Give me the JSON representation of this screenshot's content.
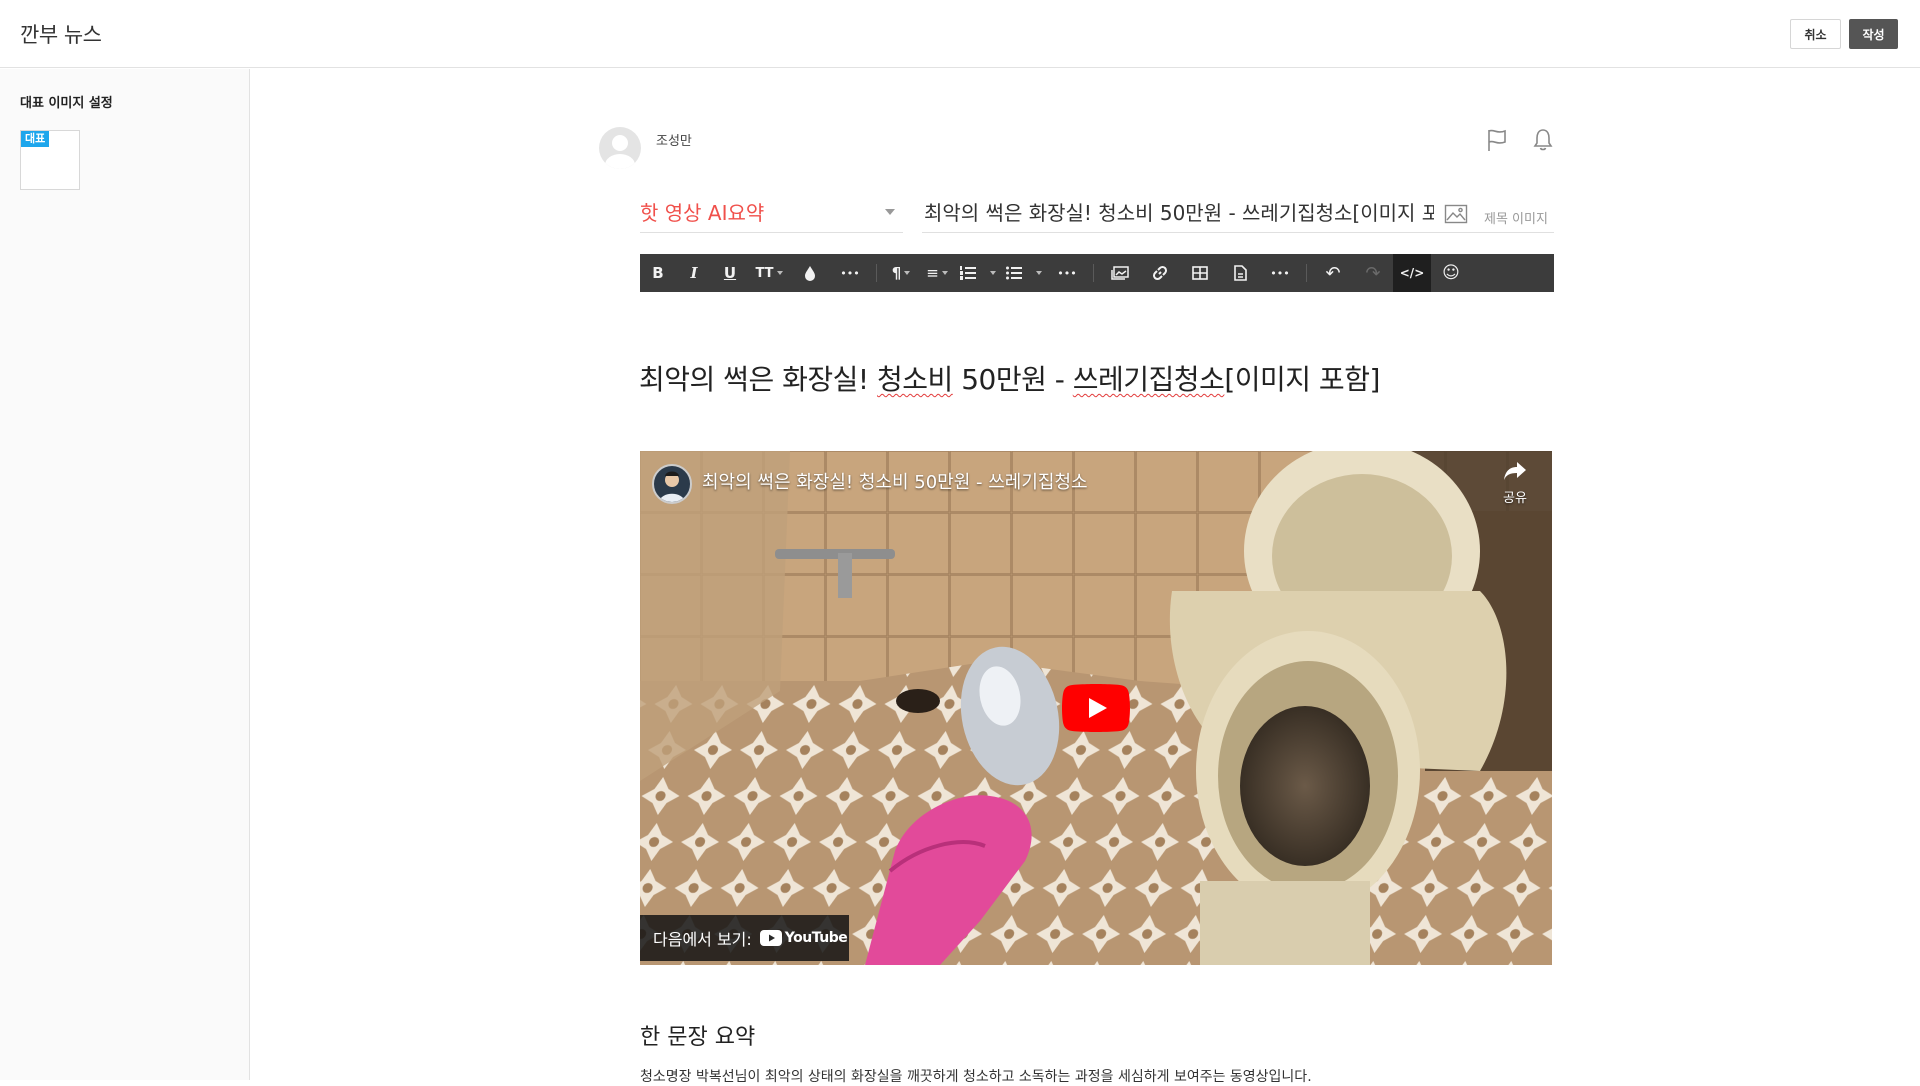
{
  "app": {
    "title": "깐부 뉴스"
  },
  "header": {
    "cancel_label": "취소",
    "write_label": "작성"
  },
  "sidebar": {
    "title": "대표 이미지 설정",
    "badge": "대표"
  },
  "author": {
    "name": "조성만"
  },
  "editor": {
    "category": "핫 영상 AI요약",
    "title_value": "최악의 썩은 화장실! 청소비 50만원 - 쓰레기집청소[이미지 포함]",
    "title_image_label": "제목 이미지"
  },
  "toolbar": {
    "bold": "B",
    "italic": "I",
    "underline": "U",
    "font_size": "TT",
    "more": "•••",
    "paragraph": "¶",
    "align": "≡",
    "ol": "≡",
    "ul": "≡",
    "undo": "↶",
    "redo": "↷",
    "code": "</>",
    "emoji": "☺"
  },
  "content": {
    "headline_parts": [
      "최악의 썩은 화장실! ",
      "청소비",
      " 50만원 - ",
      "쓰레기집청소",
      "[이미지 포함]"
    ],
    "video": {
      "title": "최악의 썩은 화장실! 청소비 50만원 - 쓰레기집청소",
      "share_label": "공유",
      "watch_on_label": "다음에서 보기:",
      "platform": "YouTube"
    },
    "summary_heading": "한 문장 요약",
    "summary_text": "청소명장 박복선님이 최악의 상태의 화장실을 깨끗하게 청소하고 소독하는 과정을 세심하게 보여주는 동영상입니다."
  },
  "colors": {
    "category": "#f0504b",
    "toolbar_bg": "#3c3c3c",
    "badge": "#1ea6ec",
    "youtube_red": "#ff0000"
  }
}
